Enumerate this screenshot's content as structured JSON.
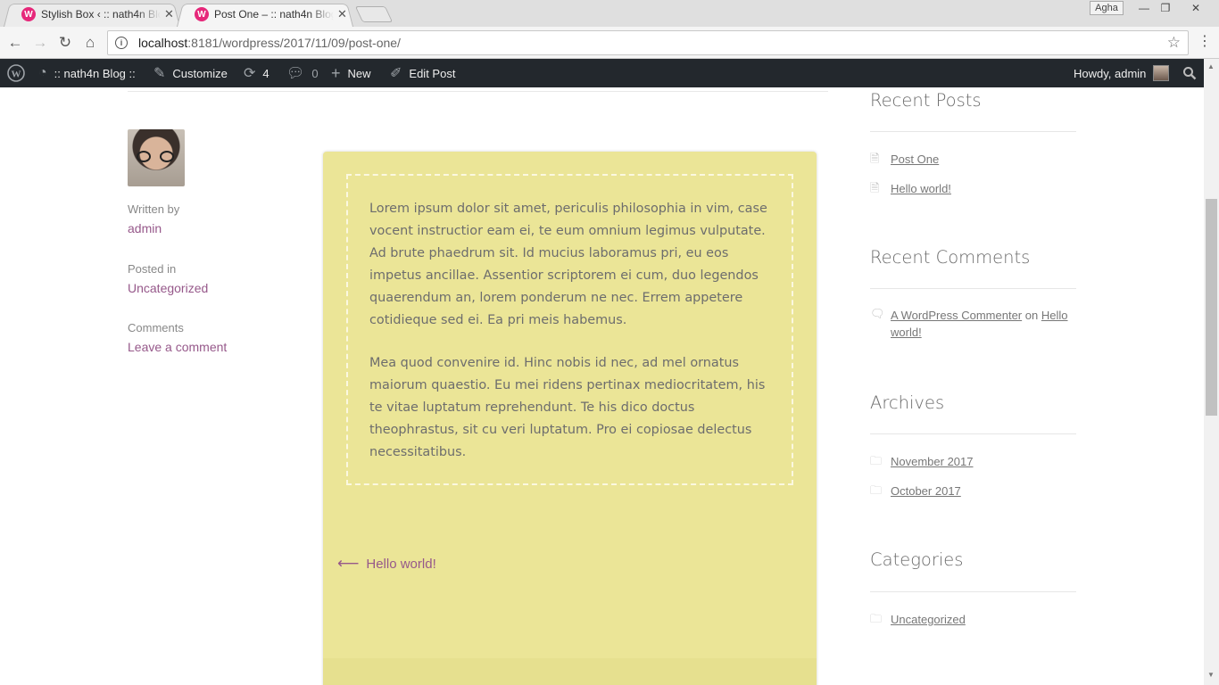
{
  "browser": {
    "tabs": [
      {
        "title": "Stylish Box ‹ :: nath4n Blog",
        "favicon": "W"
      },
      {
        "title": "Post One – :: nath4n Blog",
        "favicon": "W"
      }
    ],
    "user_badge": "Agha",
    "url_host": "localhost",
    "url_path": ":8181/wordpress/2017/11/09/post-one/"
  },
  "adminbar": {
    "site": ":: nath4n Blog ::",
    "customize": "Customize",
    "updates": "4",
    "comments": "0",
    "new": "New",
    "edit": "Edit Post",
    "howdy": "Howdy, admin"
  },
  "post_meta": {
    "written_by_label": "Written by",
    "author": "admin",
    "posted_in_label": "Posted in",
    "category": "Uncategorized",
    "comments_label": "Comments",
    "comment_link": "Leave a comment"
  },
  "post": {
    "paragraphs": [
      "Lorem ipsum dolor sit amet, periculis philosophia in vim, case vocent instructior eam ei, te eum omnium legimus vulputate. Ad brute phaedrum sit. Id mucius laboramus pri, eu eos impetus ancillae. Assentior scriptorem ei cum, duo legendos quaerendum an, lorem ponderum ne nec. Errem appetere cotidieque sed ei. Ea pri meis habemus.",
      "Mea quod convenire id. Hinc nobis id nec, ad mel ornatus maiorum quaestio. Eu mei ridens pertinax mediocritatem, his te vitae luptatum reprehendunt. Te his dico doctus theophrastus, sit cu veri luptatum. Pro ei copiosae delectus necessitatibus."
    ],
    "prev_post": "Hello world!",
    "box_color": "#ebe597"
  },
  "sidebar": {
    "recent_posts": {
      "title": "Recent Posts",
      "items": [
        "Post One",
        "Hello world!"
      ]
    },
    "recent_comments": {
      "title": "Recent Comments",
      "author": "A WordPress Commenter",
      "on": "on",
      "post": "Hello world!"
    },
    "archives": {
      "title": "Archives",
      "items": [
        "November 2017",
        "October 2017"
      ]
    },
    "categories": {
      "title": "Categories",
      "items": [
        "Uncategorized"
      ]
    }
  },
  "colors": {
    "link": "#96588a",
    "adminbar": "#23282d"
  }
}
